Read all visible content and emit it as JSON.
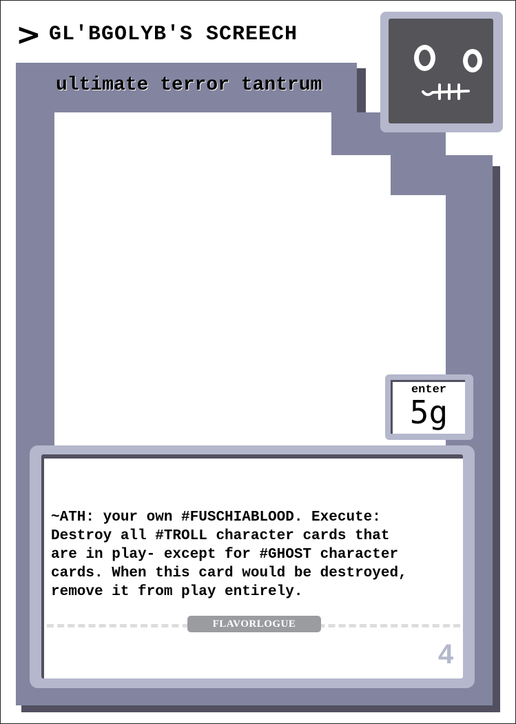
{
  "card": {
    "title": "GL'BGOLYB'S SCREECH",
    "title_arrow": ">",
    "subtitle": "ultimate terror tantrum",
    "enter_label": "enter",
    "enter_value": "5g",
    "rules_text": "~ATH: your own #FUSCHIABLOOD. Execute:\nDestroy all #TROLL character cards that\nare in play- except for #GHOST character\ncards. When this card would be destroyed,\nremove it from play entirely.",
    "flavor_label": "FLAVORLOGUE",
    "card_number": "4"
  },
  "colors": {
    "frame": "#8385a0",
    "frame_shadow": "#525060",
    "light_frame": "#b5b7cc",
    "portrait_bg": "#555559",
    "badge": "#9a9ca0"
  },
  "icons": {
    "title_marker": "chevron-right-icon",
    "portrait": "stitched-face-icon"
  }
}
